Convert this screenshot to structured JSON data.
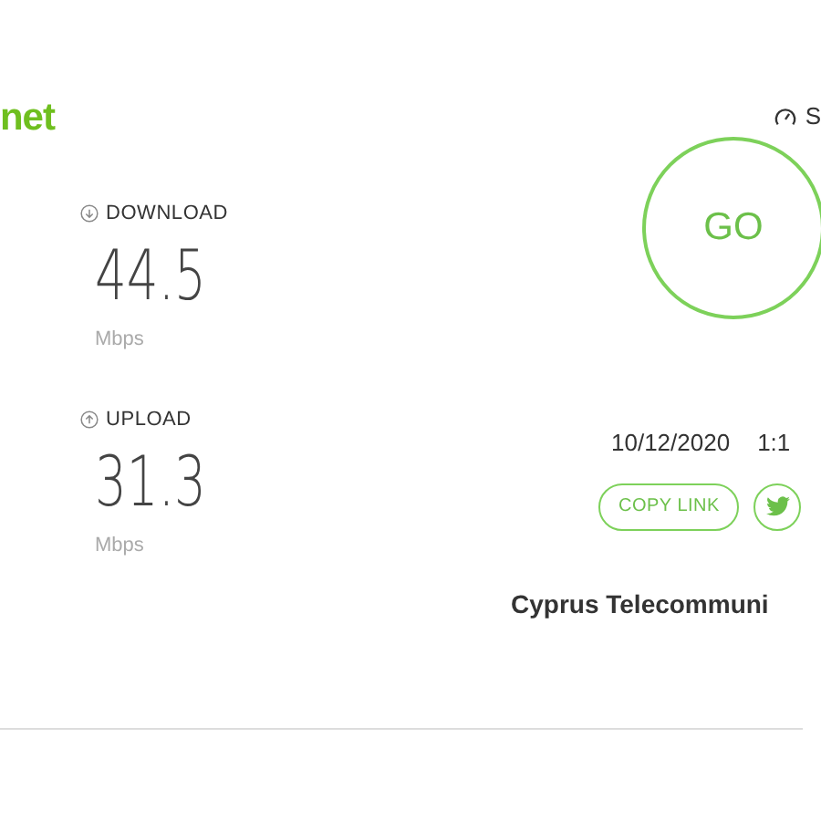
{
  "header": {
    "logo": "net",
    "link": "S"
  },
  "results": [
    {
      "kind": "download",
      "label": "DOWNLOAD",
      "value": "44.5",
      "unit": "Mbps"
    },
    {
      "kind": "upload",
      "label": "UPLOAD",
      "value": "31.3",
      "unit": "Mbps"
    }
  ],
  "go_button": "GO",
  "date": "10/12/2020",
  "time": "1:1",
  "copy_link": "COPY LINK",
  "provider": "Cyprus Telecommuni"
}
